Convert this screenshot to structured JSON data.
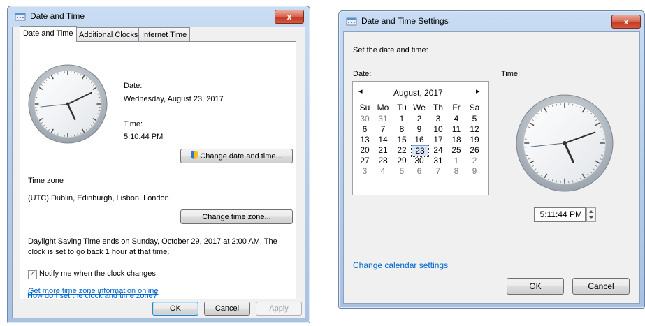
{
  "dlg1": {
    "title": "Date and Time",
    "close_label": "x",
    "tabs": [
      "Date and Time",
      "Additional Clocks",
      "Internet Time"
    ],
    "date_label": "Date:",
    "date_value": "Wednesday, August 23, 2017",
    "time_label": "Time:",
    "time_value": "5:10:44 PM",
    "change_datetime_button": "Change date and time...",
    "timezone_header": "Time zone",
    "timezone_value": "(UTC) Dublin, Edinburgh, Lisbon, London",
    "change_timezone_button": "Change time zone...",
    "dst_line1": "Daylight Saving Time ends on Sunday, October 29, 2017 at 2:00 AM. The",
    "dst_line2": "clock is set to go back 1 hour at that time.",
    "notify_label": "Notify me when the clock changes",
    "notify_checked": true,
    "link_more_info": "Get more time zone information online",
    "link_how_set": "How do I set the clock and time zone?",
    "ok": "OK",
    "cancel": "Cancel",
    "apply": "Apply",
    "clock": {
      "hour": 5,
      "minute": 10,
      "second": 44
    }
  },
  "dlg2": {
    "title": "Date and Time Settings",
    "close_label": "x",
    "subtitle": "Set the date and time:",
    "date_label": "Date:",
    "time_label": "Time:",
    "calendar": {
      "month_label": "August, 2017",
      "prev_arrow": "◂",
      "next_arrow": "▸",
      "weekdays": [
        "Su",
        "Mo",
        "Tu",
        "We",
        "Th",
        "Fr",
        "Sa"
      ],
      "weeks": [
        [
          "30",
          "31",
          "1",
          "2",
          "3",
          "4",
          "5"
        ],
        [
          "6",
          "7",
          "8",
          "9",
          "10",
          "11",
          "12"
        ],
        [
          "13",
          "14",
          "15",
          "16",
          "17",
          "18",
          "19"
        ],
        [
          "20",
          "21",
          "22",
          "23",
          "24",
          "25",
          "26"
        ],
        [
          "27",
          "28",
          "29",
          "30",
          "31",
          "1",
          "2"
        ],
        [
          "3",
          "4",
          "5",
          "6",
          "7",
          "8",
          "9"
        ]
      ],
      "selected": "23"
    },
    "time_value": "5:11:44 PM",
    "change_calendar_link": "Change calendar settings",
    "ok": "OK",
    "cancel": "Cancel",
    "clock": {
      "hour": 5,
      "minute": 11,
      "second": 44
    }
  },
  "colors": {
    "frame": "#b4cbe8",
    "link": "#0066cc",
    "close": "#c03a24"
  }
}
